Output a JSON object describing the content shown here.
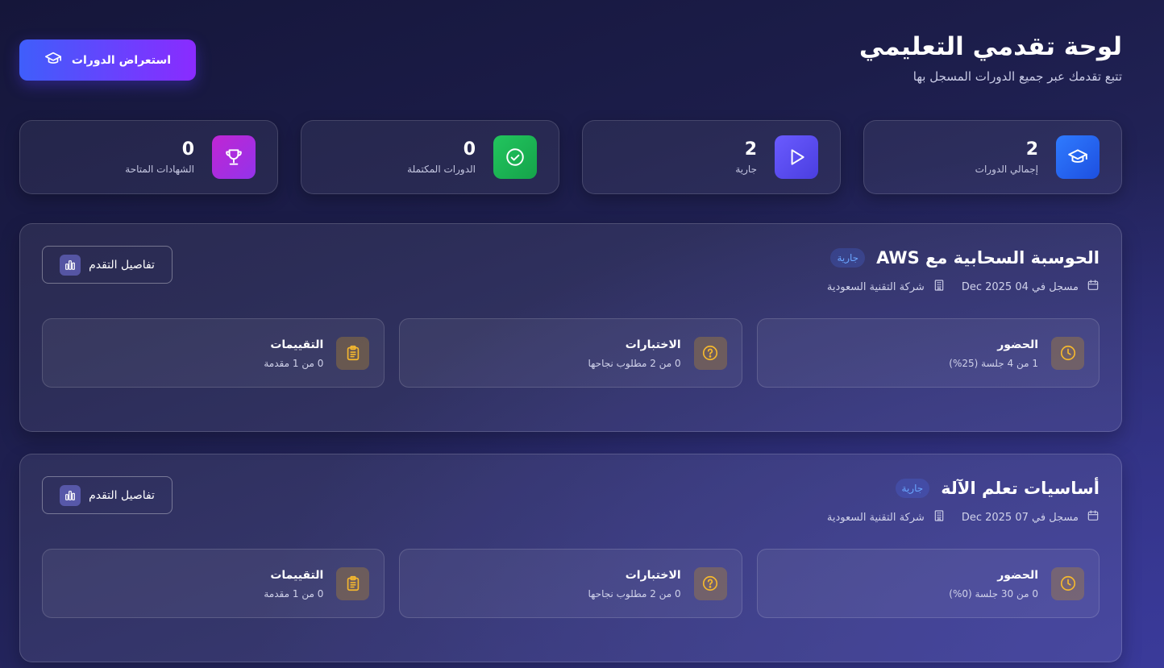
{
  "header": {
    "title": "لوحة تقدمي التعليمي",
    "subtitle": "تتبع تقدمك عبر جميع الدورات المسجل بها",
    "browse_button": "استعراض الدورات"
  },
  "stats": [
    {
      "value": "2",
      "label": "إجمالي الدورات",
      "icon": "graduation-cap-icon",
      "color": "#2563eb"
    },
    {
      "value": "2",
      "label": "جارية",
      "icon": "play-icon",
      "color": "#5b4cf0"
    },
    {
      "value": "0",
      "label": "الدورات المكتملة",
      "icon": "check-circle-icon",
      "color": "#16a34a"
    },
    {
      "value": "0",
      "label": "الشهادات المتاحة",
      "icon": "trophy-icon",
      "color": "#a21caf"
    }
  ],
  "courses": [
    {
      "title": "الحوسبة السحابية مع AWS",
      "status": "جارية",
      "enrolled": "مسجل في 04 Dec 2025",
      "company": "شركة التقنية السعودية",
      "details_button": "تفاصيل التقدم",
      "metrics": [
        {
          "title": "الحضور",
          "sub": "1 من 4 جلسة (25%)",
          "icon": "clock-icon"
        },
        {
          "title": "الاختبارات",
          "sub": "0 من 2 مطلوب نجاحها",
          "icon": "question-circle-icon"
        },
        {
          "title": "التقييمات",
          "sub": "0 من 1 مقدمة",
          "icon": "clipboard-icon"
        }
      ]
    },
    {
      "title": "أساسيات تعلم الآلة",
      "status": "جارية",
      "enrolled": "مسجل في 07 Dec 2025",
      "company": "شركة التقنية السعودية",
      "details_button": "تفاصيل التقدم",
      "metrics": [
        {
          "title": "الحضور",
          "sub": "0 من 30 جلسة (0%)",
          "icon": "clock-icon"
        },
        {
          "title": "الاختبارات",
          "sub": "0 من 2 مطلوب نجاحها",
          "icon": "question-circle-icon"
        },
        {
          "title": "التقييمات",
          "sub": "0 من 1 مقدمة",
          "icon": "clipboard-icon"
        }
      ]
    }
  ],
  "colors": {
    "accent_start": "#3f5efb",
    "accent_end": "#8a2bff",
    "badge_text": "#6aa6ff",
    "metric_icon": "#f5b82e"
  }
}
